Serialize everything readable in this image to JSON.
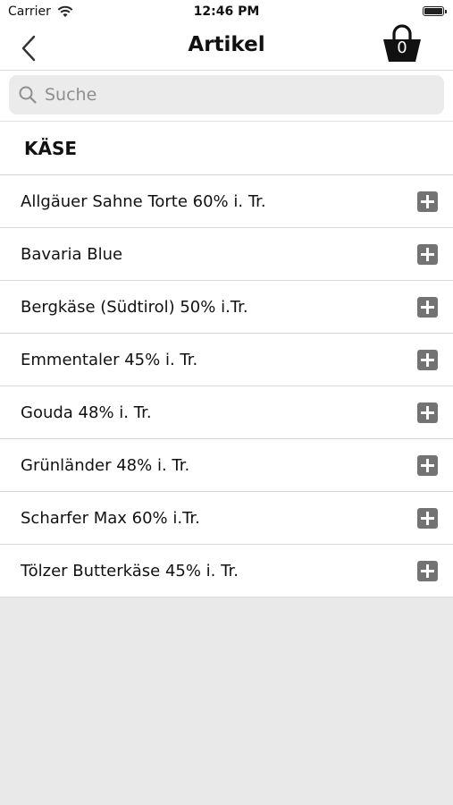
{
  "status_bar": {
    "carrier": "Carrier",
    "time": "12:46 PM"
  },
  "nav": {
    "title": "Artikel",
    "back_icon": "chevron-left-icon",
    "cart_icon": "shopping-basket-icon",
    "cart_count": "0"
  },
  "search": {
    "placeholder": "Suche",
    "value": ""
  },
  "section": {
    "title": "KÄSE"
  },
  "items": [
    {
      "label": "Allgäuer Sahne Torte 60% i. Tr."
    },
    {
      "label": "Bavaria Blue"
    },
    {
      "label": "Bergkäse (Südtirol) 50% i.Tr."
    },
    {
      "label": "Emmentaler 45% i. Tr."
    },
    {
      "label": "Gouda 48% i. Tr."
    },
    {
      "label": "Grünländer 48% i. Tr."
    },
    {
      "label": "Scharfer Max 60% i.Tr."
    },
    {
      "label": "Tölzer Butterkäse 45% i. Tr."
    }
  ],
  "colors": {
    "background": "#e9e9e9",
    "add_button": "#737373",
    "search_field": "#ebebeb"
  }
}
